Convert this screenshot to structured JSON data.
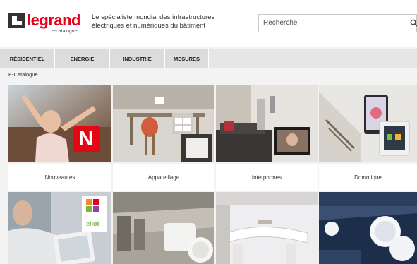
{
  "header": {
    "logo_text": "legrand",
    "logo_sub": "e-catalogue",
    "tagline": "Le spécialiste mondial des infrastructures électriques et numériques du bâtiment"
  },
  "search": {
    "placeholder": "Recherche"
  },
  "nav": {
    "items": [
      {
        "label": "RÉSIDENTIEL"
      },
      {
        "label": "ENERGIE"
      },
      {
        "label": "INDUSTRIE"
      },
      {
        "label": "MESURES"
      }
    ]
  },
  "breadcrumb": "E-Catalogue",
  "tiles": [
    {
      "label": "Nouveautés",
      "badge": "N"
    },
    {
      "label": "Appareillage"
    },
    {
      "label": "Interphones"
    },
    {
      "label": "Domotique"
    }
  ],
  "tiles_row2": {
    "eliot_label": "eliot"
  },
  "colors": {
    "brand": "#e2001a",
    "nav_bg": "#dcdcdc"
  }
}
